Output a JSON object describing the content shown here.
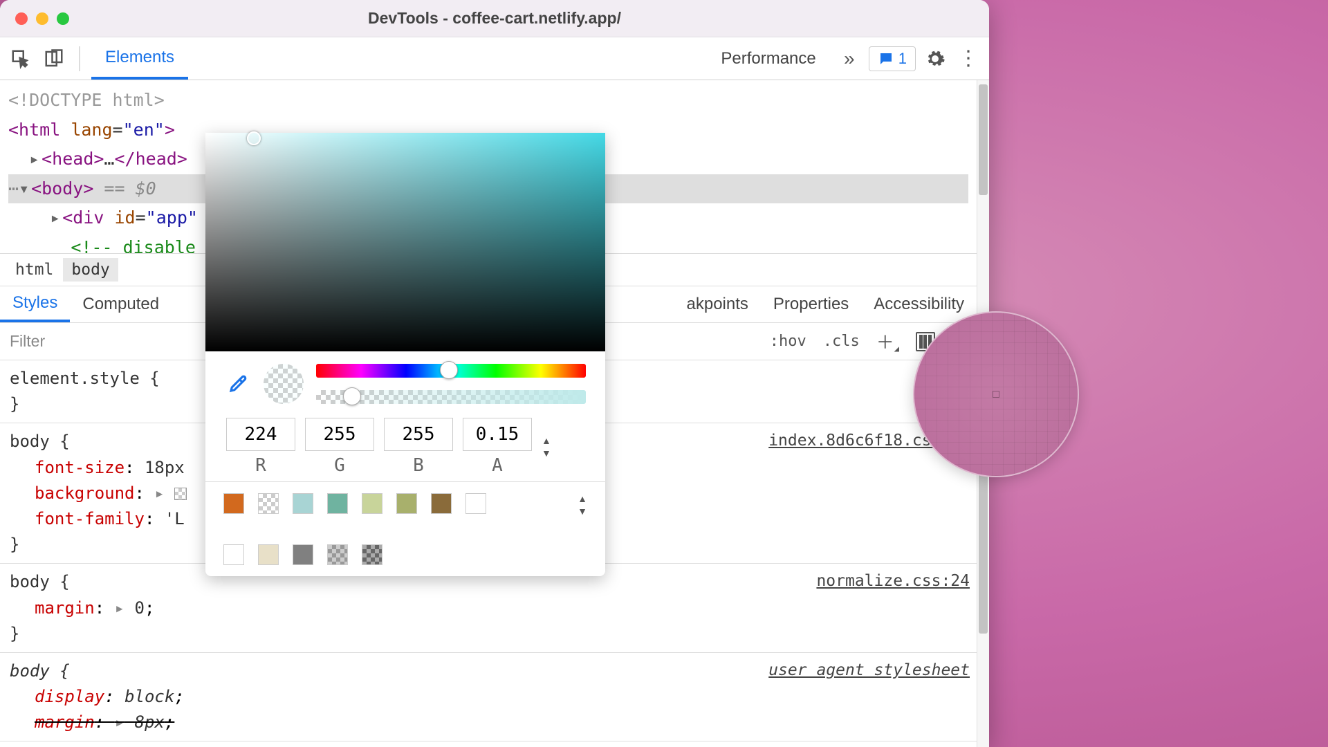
{
  "window": {
    "title": "DevTools - coffee-cart.netlify.app/"
  },
  "toolbar": {
    "tabs": [
      "Elements",
      "Performance"
    ],
    "issues_count": "1"
  },
  "dom": {
    "doctype": "<!DOCTYPE html>",
    "html_open": "<html lang=\"en\">",
    "head": "<head>…</head>",
    "body_sel": "<body>",
    "body_eq": " == $0",
    "div_app": "<div id=\"app\"",
    "comment": "<!-- disable",
    "comment_close": ">"
  },
  "crumbs": [
    "html",
    "body"
  ],
  "subtabs": {
    "styles": "Styles",
    "computed": "Computed",
    "breakpoints": "akpoints",
    "properties": "Properties",
    "accessibility": "Accessibility"
  },
  "filter": {
    "placeholder": "Filter",
    "hov": ":hov",
    "cls": ".cls"
  },
  "rules": {
    "element_style": "element.style {",
    "brace_close": "}",
    "body1": {
      "sel": "body {",
      "src": "index.8d6c6f18.css:64",
      "p1n": "font-size",
      "p1v": "18px",
      "p2n": "background",
      "p3n": "font-family",
      "p3v": "'L"
    },
    "body2": {
      "sel": "body {",
      "src": "normalize.css:24",
      "p1n": "margin",
      "p1v": "0"
    },
    "body3": {
      "sel": "body {",
      "src": "user agent stylesheet",
      "p1n": "display",
      "p1v": "block",
      "p2n": "margin",
      "p2v": "8px"
    }
  },
  "picker": {
    "rgba": {
      "r": "224",
      "g": "255",
      "b": "255",
      "a": "0.15"
    },
    "labels": {
      "r": "R",
      "g": "G",
      "b": "B",
      "a": "A"
    },
    "swatches": [
      "#d2691e",
      "#ffffff",
      "#a8d4d4",
      "#6fb3a0",
      "#c8d49a",
      "#a8b06c",
      "#8a6b3a",
      "#ffffff",
      "#ffffff",
      "#e8e0c8",
      "#808080",
      "#a8a8a8",
      "#707070"
    ]
  }
}
